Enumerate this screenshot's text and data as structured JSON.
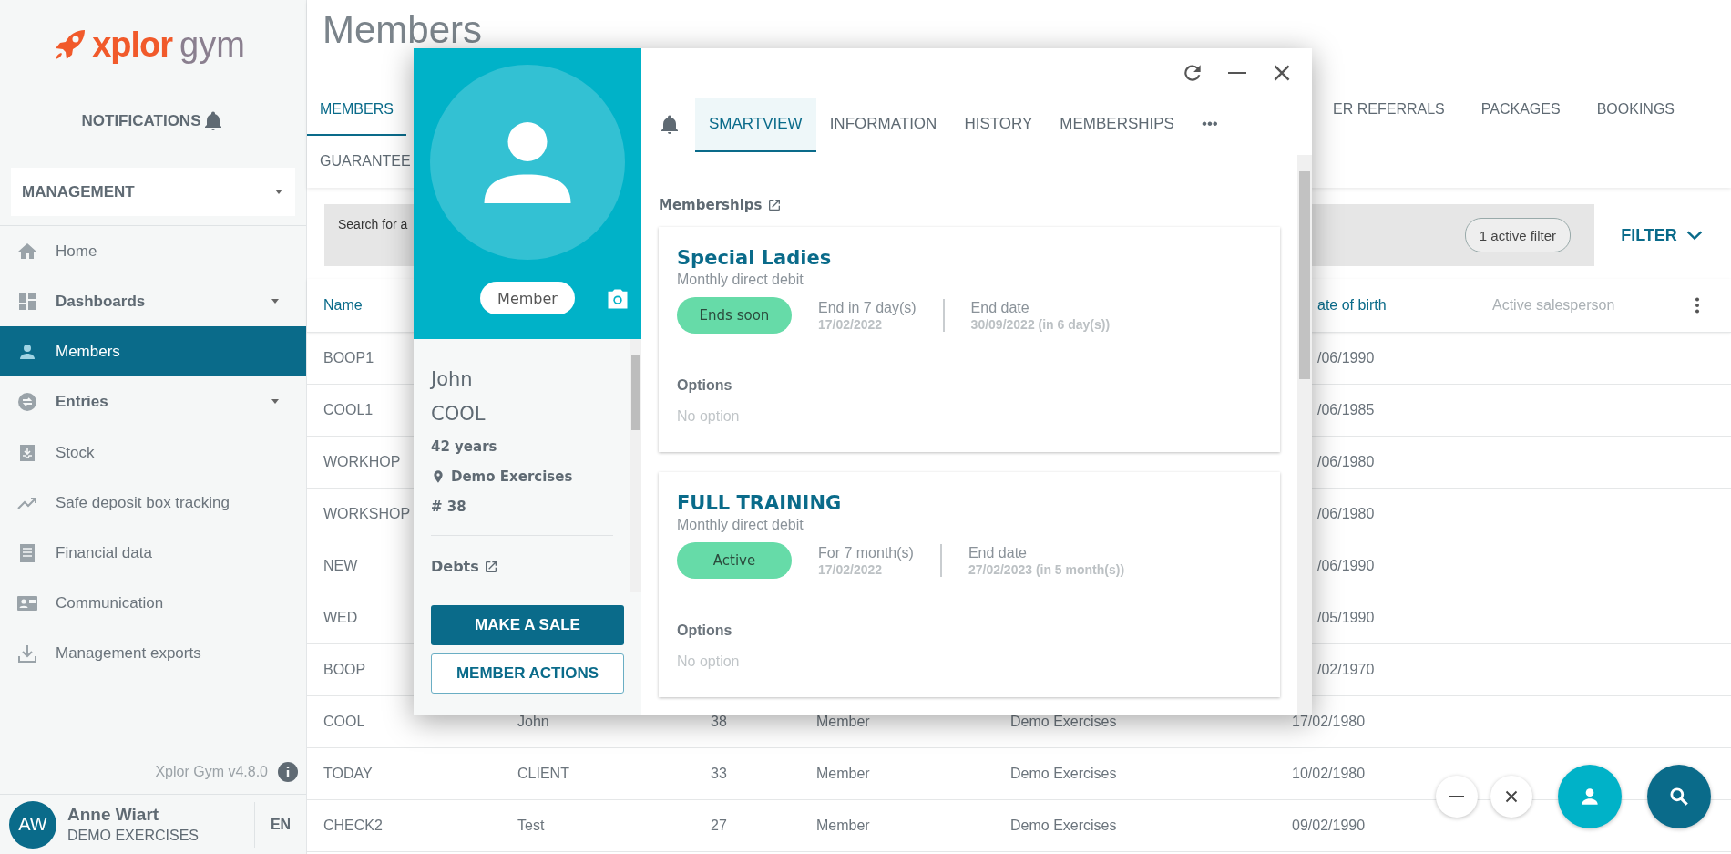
{
  "sidebar": {
    "logo": {
      "brand": "xplor",
      "suffix": "gym"
    },
    "notifications": "NOTIFICATIONS",
    "section_select": "MANAGEMENT",
    "sections": [
      {
        "items": [
          {
            "label": "Home",
            "kind": "link",
            "selected": false
          },
          {
            "label": "Dashboards",
            "kind": "group",
            "selected": false
          },
          {
            "label": "Members",
            "kind": "link",
            "selected": true
          },
          {
            "label": "Entries",
            "kind": "group",
            "selected": false
          }
        ]
      },
      {
        "items": [
          {
            "label": "Stock",
            "kind": "link",
            "selected": false
          },
          {
            "label": "Safe deposit box tracking",
            "kind": "link",
            "selected": false
          },
          {
            "label": "Financial data",
            "kind": "link",
            "selected": false
          },
          {
            "label": "Communication",
            "kind": "link",
            "selected": false
          },
          {
            "label": "Management exports",
            "kind": "link",
            "selected": false
          }
        ]
      }
    ],
    "version": "Xplor Gym v4.8.0",
    "user": {
      "initials": "AW",
      "name": "Anne Wiart",
      "club": "DEMO EXERCISES",
      "language": "EN"
    }
  },
  "page": {
    "title": "Members",
    "tabs": [
      {
        "label": "MEMBERS",
        "selected": true
      }
    ],
    "tabs_right": [
      {
        "label": "ER REFERRALS",
        "selected": false
      },
      {
        "label": "PACKAGES",
        "selected": false
      },
      {
        "label": "BOOKINGS",
        "selected": false
      }
    ],
    "tabs_row2": [
      {
        "label": "GUARANTEE",
        "selected": false
      }
    ],
    "search": {
      "placeholder": "Search for a"
    },
    "filter_chip": "1 active filter",
    "filter_button": "FILTER"
  },
  "table": {
    "columns": {
      "name": "Name",
      "date_of_birth": "ate of birth",
      "active_salesperson": "Active salesperson"
    },
    "rows": [
      {
        "name": "BOOP1",
        "date_of_birth": "/06/1990"
      },
      {
        "name": "COOL1",
        "date_of_birth": "/06/1985"
      },
      {
        "name": "WORKHOP",
        "date_of_birth": "/06/1980"
      },
      {
        "name": "WORKSHOP",
        "date_of_birth": "/06/1980"
      },
      {
        "name": "NEW",
        "date_of_birth": "/06/1990"
      },
      {
        "name": "WED",
        "date_of_birth": "/05/1990"
      },
      {
        "name": "BOOP",
        "date_of_birth": "/02/1970"
      },
      {
        "name": "COOL",
        "first_name": "John",
        "number": "38",
        "type": "Member",
        "club": "Demo Exercises",
        "date_of_birth": "17/02/1980"
      },
      {
        "name": "TODAY",
        "first_name": "CLIENT",
        "number": "33",
        "type": "Member",
        "club": "Demo Exercises",
        "date_of_birth": "10/02/1980"
      },
      {
        "name": "CHECK2",
        "first_name": "Test",
        "number": "27",
        "type": "Member",
        "club": "Demo Exercises",
        "date_of_birth": "09/02/1990"
      }
    ]
  },
  "member_popup": {
    "badge": "Member",
    "first_name": "John",
    "last_name": "COOL",
    "age": "42 years",
    "club": "Demo Exercises",
    "number": "# 38",
    "debts": "Debts",
    "actions": [
      {
        "label": "MAKE A SALE",
        "kind": "primary"
      },
      {
        "label": "MEMBER ACTIONS",
        "kind": "outline"
      }
    ],
    "tabs": [
      {
        "label": "SMARTVIEW",
        "selected": true
      },
      {
        "label": "INFORMATION",
        "selected": false
      },
      {
        "label": "HISTORY",
        "selected": false
      },
      {
        "label": "MEMBERSHIPS",
        "selected": false
      },
      {
        "label": "•••",
        "selected": false
      }
    ],
    "section_title": "Memberships",
    "memberships": [
      {
        "name": "Special Ladies",
        "payment": "Monthly direct debit",
        "status": "Ends soon",
        "duration": "End in 7 day(s)",
        "start_date": "17/02/2022",
        "end_label": "End date",
        "end_date": "30/09/2022 (in 6 day(s))",
        "options_label": "Options",
        "options_text": "No option"
      },
      {
        "name": "FULL TRAINING",
        "payment": "Monthly direct debit",
        "status": "Active",
        "duration": "For 7 month(s)",
        "start_date": "17/02/2022",
        "end_label": "End date",
        "end_date": "27/02/2023 (in 5 month(s))",
        "options_label": "Options",
        "options_text": "No option"
      }
    ]
  }
}
